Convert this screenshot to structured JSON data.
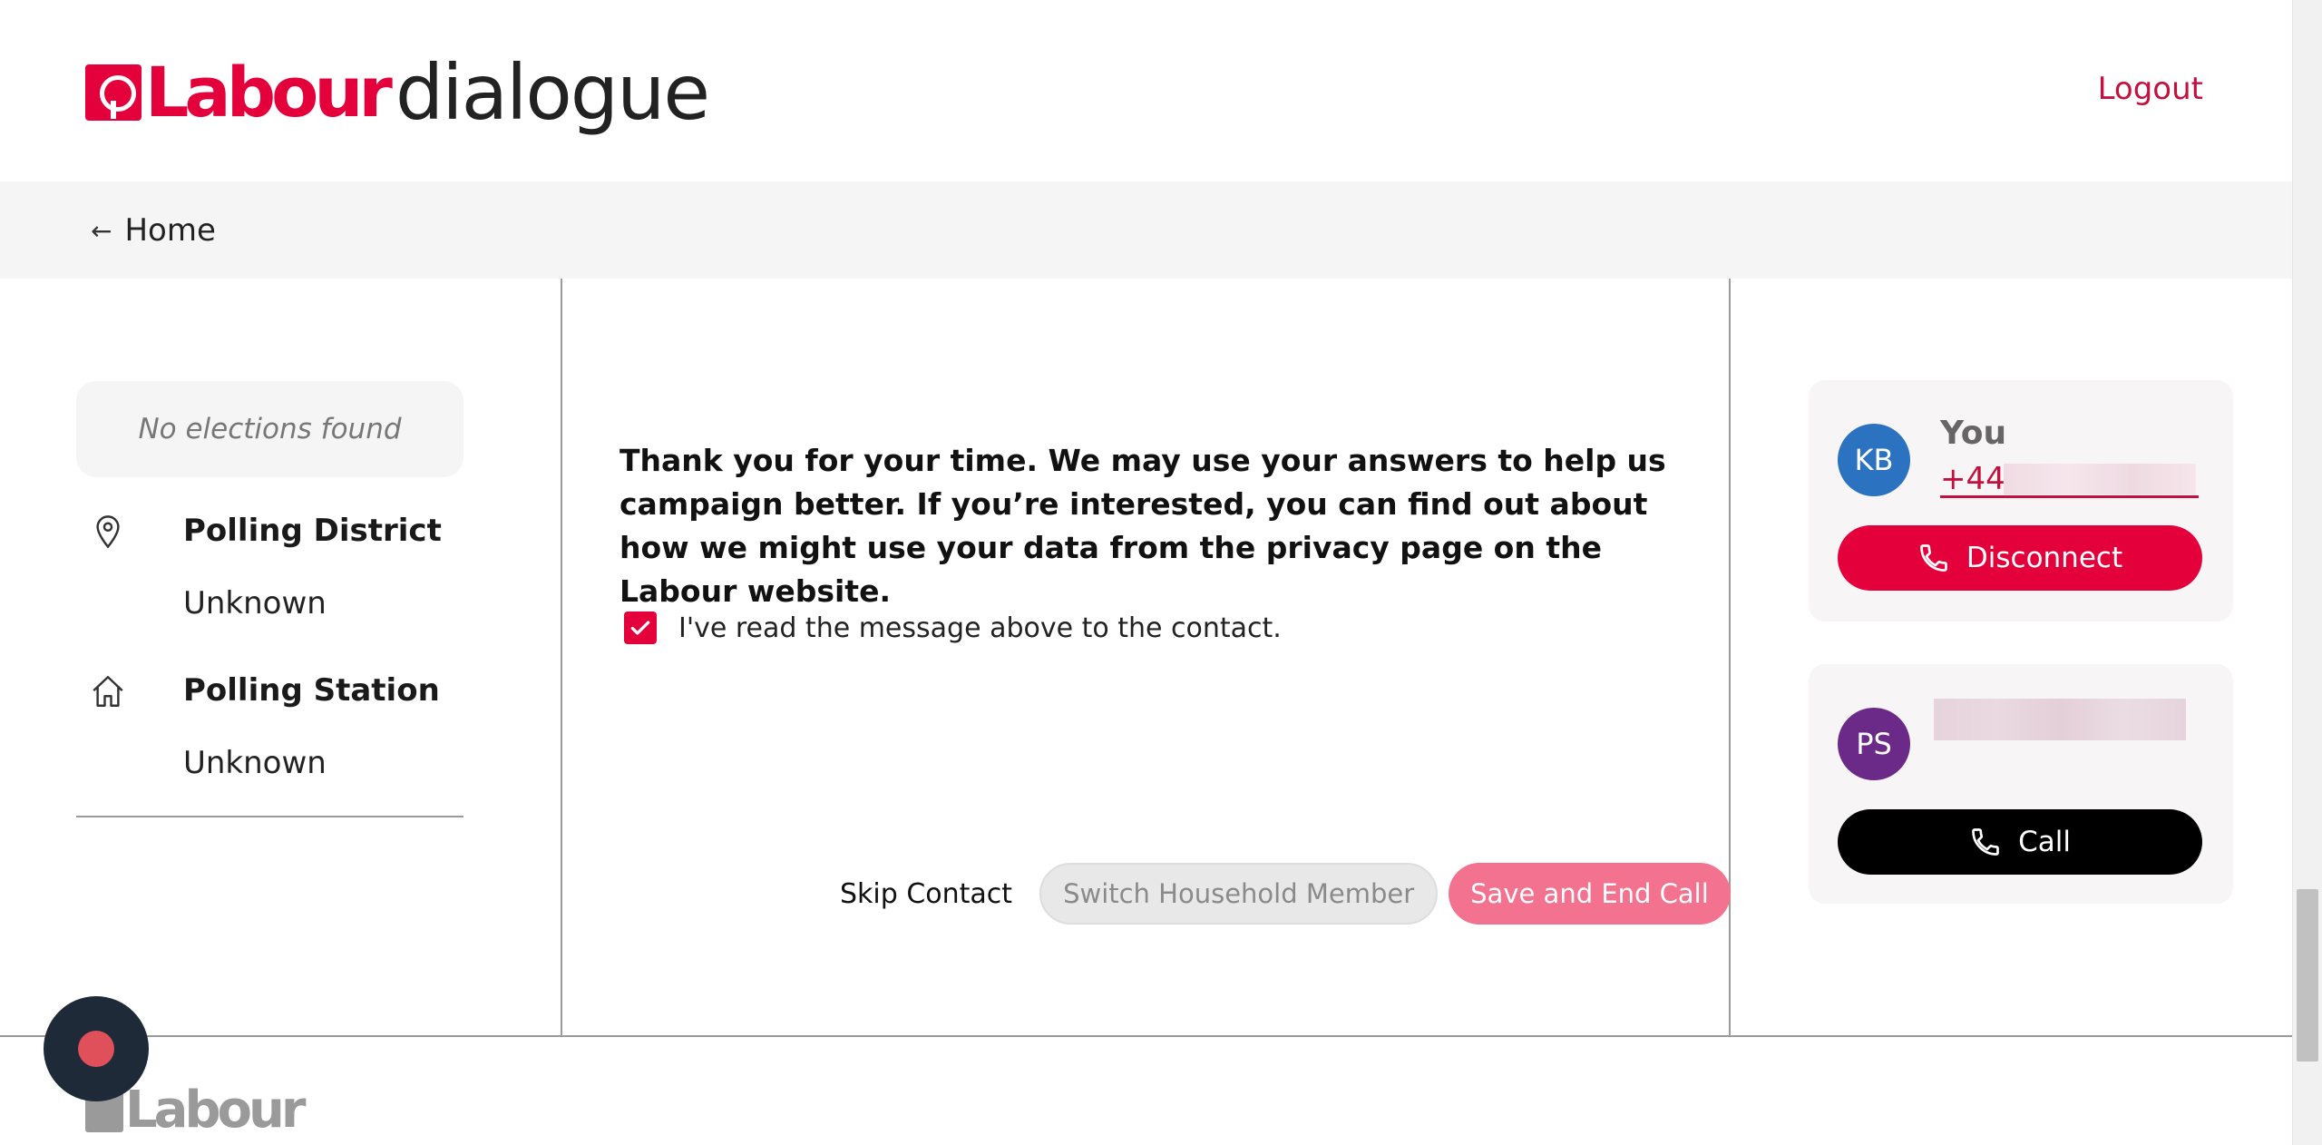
{
  "header": {
    "logo_labour": "Labour",
    "logo_dialogue": "dialogue",
    "logout_label": "Logout"
  },
  "breadcrumb": {
    "home_label": "Home"
  },
  "sidebar": {
    "no_elections": "No elections found",
    "polling_district": {
      "title": "Polling District",
      "value": "Unknown"
    },
    "polling_station": {
      "title": "Polling Station",
      "value": "Unknown"
    }
  },
  "main": {
    "message": "Thank you for your time. We may use your answers to help us campaign better. If you’re interested, you can find out about how we might use your data from the privacy page on the Labour website.",
    "checkbox_label": "I've read the message above to the contact.",
    "checkbox_checked": true,
    "skip_label": "Skip Contact",
    "switch_label": "Switch Household Member",
    "save_label": "Save and End Call"
  },
  "caller": {
    "initials": "KB",
    "name": "You",
    "phone_prefix": "+44",
    "button_label": "Disconnect",
    "avatar_color": "#2b72c0",
    "button_color": "#e4003b"
  },
  "contact": {
    "initials": "PS",
    "button_label": "Call",
    "avatar_color": "#6b2a87",
    "button_color": "#000000"
  },
  "footer": {
    "logo_text": "Labour"
  },
  "colors": {
    "brand": "#e4003b",
    "link": "#c4103f",
    "save_disabled": "#f2728f"
  }
}
